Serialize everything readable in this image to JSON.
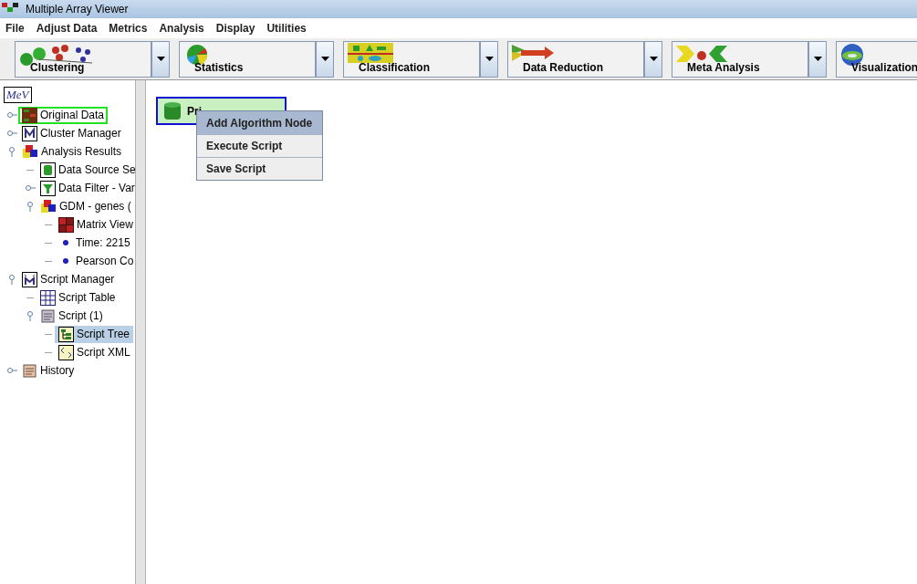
{
  "window": {
    "title": "Multiple Array Viewer"
  },
  "menu_bar": [
    "File",
    "Adjust Data",
    "Metrics",
    "Analysis",
    "Display",
    "Utilities"
  ],
  "toolbar": [
    {
      "label": "Clustering",
      "kind": "clustering"
    },
    {
      "label": "Statistics",
      "kind": "statistics"
    },
    {
      "label": "Classification",
      "kind": "classification"
    },
    {
      "label": "Data Reduction",
      "kind": "reduction"
    },
    {
      "label": "Meta Analysis",
      "kind": "meta"
    },
    {
      "label": "Visualization",
      "kind": "visualization"
    }
  ],
  "tree": {
    "root_logo": "MeV",
    "items": [
      {
        "label": "Original Data",
        "kind": "data",
        "focused": true,
        "selected": false,
        "expanded": false
      },
      {
        "label": "Cluster Manager",
        "kind": "manager",
        "selected": false,
        "expanded": false
      },
      {
        "label": "Analysis Results",
        "kind": "results",
        "selected": false,
        "expanded": true,
        "children": [
          {
            "label": "Data Source Se",
            "kind": "source",
            "selected": false
          },
          {
            "label": "Data Filter - Var",
            "kind": "filter",
            "selected": false,
            "expanded": false
          },
          {
            "label": "GDM - genes (",
            "kind": "results",
            "selected": false,
            "expanded": true,
            "children": [
              {
                "label": "Matrix View",
                "kind": "matrix",
                "selected": false
              },
              {
                "label": "Time: 2215",
                "kind": "bullet",
                "selected": false
              },
              {
                "label": "Pearson Co",
                "kind": "bullet",
                "selected": false
              }
            ]
          }
        ]
      },
      {
        "label": "Script Manager",
        "kind": "script_manager",
        "selected": false,
        "expanded": true,
        "children": [
          {
            "label": "Script Table",
            "kind": "table",
            "selected": false
          },
          {
            "label": "Script (1)",
            "kind": "scroll",
            "selected": false,
            "expanded": true,
            "children": [
              {
                "label": "Script Tree",
                "kind": "tree_view",
                "selected": true
              },
              {
                "label": "Script XML",
                "kind": "xml_view",
                "selected": false
              }
            ]
          }
        ]
      },
      {
        "label": "History",
        "kind": "history",
        "selected": false,
        "expanded": false
      }
    ]
  },
  "canvas": {
    "node": {
      "label": "Pri"
    },
    "context_menu": [
      {
        "label": "Add Algorithm Node",
        "selected": true
      },
      {
        "label": "Execute Script",
        "selected": false
      },
      {
        "label": "Save Script",
        "selected": false
      }
    ]
  }
}
